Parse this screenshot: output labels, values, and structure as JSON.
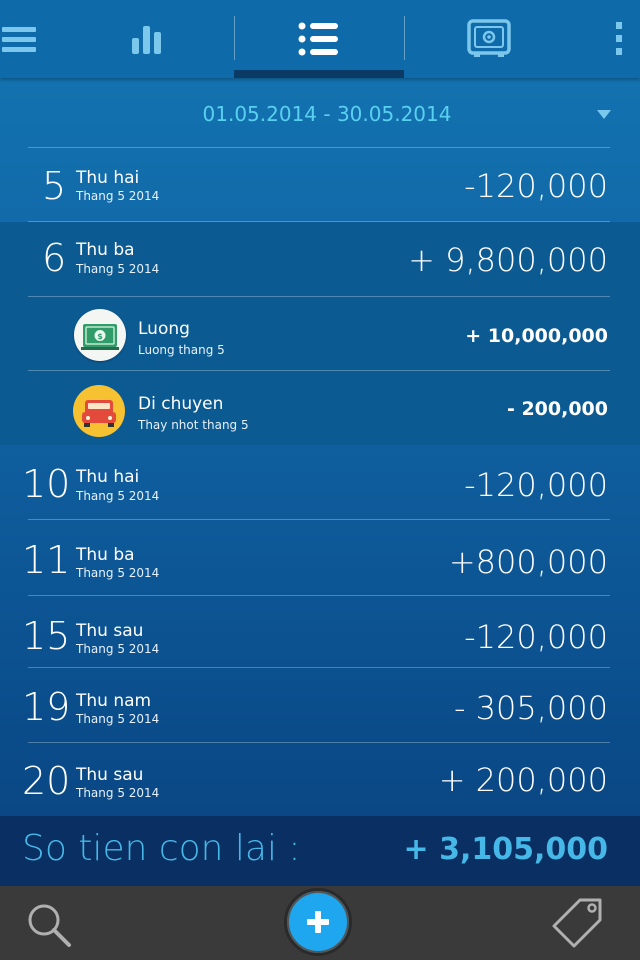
{
  "date_range": "01.05.2014 - 30.05.2014",
  "rows": [
    {
      "day": "5",
      "weekday": "Thu hai",
      "month": "Thang 5 2014",
      "amount": "-120,000"
    },
    {
      "day": "6",
      "weekday": "Thu ba",
      "month": "Thang 5 2014",
      "amount": "+ 9,800,000",
      "items": [
        {
          "icon": "money-bill-icon",
          "title": "Luong",
          "note": "Luong thang 5",
          "amount": "+ 10,000,000"
        },
        {
          "icon": "car-icon",
          "title": "Di chuyen",
          "note": "Thay nhot thang 5",
          "amount": "- 200,000"
        }
      ]
    },
    {
      "day": "10",
      "weekday": "Thu hai",
      "month": "Thang 5 2014",
      "amount": "-120,000"
    },
    {
      "day": "11",
      "weekday": "Thu ba",
      "month": "Thang 5 2014",
      "amount": "+800,000"
    },
    {
      "day": "15",
      "weekday": "Thu sau",
      "month": "Thang 5 2014",
      "amount": "-120,000"
    },
    {
      "day": "19",
      "weekday": "Thu nam",
      "month": "Thang 5 2014",
      "amount": "- 305,000"
    },
    {
      "day": "20",
      "weekday": "Thu sau",
      "month": "Thang 5 2014",
      "amount": "+ 200,000"
    }
  ],
  "balance": {
    "label": "So tien con lai :",
    "value": "+ 3,105,000"
  },
  "colors": {
    "accent": "#1ea7ef",
    "balance_text": "#46b8e8",
    "date_text": "#5ad0f0"
  }
}
